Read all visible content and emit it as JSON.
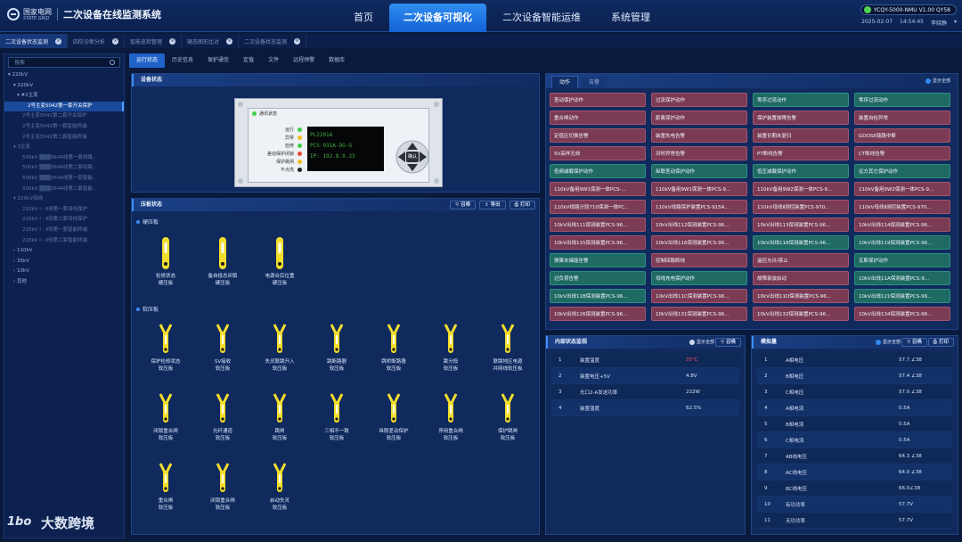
{
  "header": {
    "logo_cn": "国家电网",
    "logo_en": "STATE GRID",
    "title": "二次设备在线监测系统",
    "nav": [
      {
        "label": "首页"
      },
      {
        "label": "二次设备可视化"
      },
      {
        "label": "二次设备智能运维"
      },
      {
        "label": "系统管理"
      }
    ],
    "device": "YCQY-5000-NMU V1.00 QY58",
    "date": "2025-02-07",
    "time": "14:54:45",
    "user": "李晓静"
  },
  "tabs": [
    {
      "label": "二次设备状态监测"
    },
    {
      "label": "四防诊断分析"
    },
    {
      "label": "智能巡检管理"
    },
    {
      "label": "硬态图形比对"
    },
    {
      "label": "二次设备状态监测"
    }
  ],
  "sidebar": {
    "search_placeholder": "搜索",
    "tree": [
      {
        "label": "▾ 220kV"
      },
      {
        "label": "  ▾ 220kV"
      },
      {
        "label": "    ▾ #2主变"
      },
      {
        "label": "2号主变5042第一套开关保护"
      },
      {
        "label": "2号主变5042第二套开关保护"
      },
      {
        "label": "2号主变5042第一套智能终端"
      },
      {
        "label": "2号主变5042第二套智能终端"
      },
      {
        "label": "  ▾ 3主变"
      },
      {
        "label": "500kV ▒▒▒5644线第一套线路..."
      },
      {
        "label": "500kV ▒▒▒5644线第二套线路..."
      },
      {
        "label": "500kV ▒▒▒5644线第一套智能..."
      },
      {
        "label": "500kV ▒▒▒5644线第二套智能..."
      },
      {
        "label": "  ▾ 220kV母线"
      },
      {
        "label": "220kV Ⅰ - Ⅱ母第一套母线保护"
      },
      {
        "label": "220kV Ⅰ - Ⅱ母第二套母线保护"
      },
      {
        "label": "220kV Ⅰ - Ⅱ母第一套智能终端"
      },
      {
        "label": "220kV Ⅰ - Ⅱ母第二套智能终端"
      },
      {
        "label": "› 110kV"
      },
      {
        "label": "› 35kV"
      },
      {
        "label": "› 10kV"
      },
      {
        "label": "› 其他"
      }
    ]
  },
  "main_tabs": [
    {
      "label": "运行状态"
    },
    {
      "label": "历史信息"
    },
    {
      "label": "保护通信"
    },
    {
      "label": "定值"
    },
    {
      "label": "文件"
    },
    {
      "label": "远程预警"
    },
    {
      "label": "数据库"
    }
  ],
  "device_status": {
    "title": "设备状态",
    "comm_label": "通讯状态",
    "leds": [
      {
        "label": "运行",
        "color": "#3fd14a"
      },
      {
        "label": "异常",
        "color": "#f0c020"
      },
      {
        "label": "检修",
        "color": "#3fd14a"
      },
      {
        "label": "差动保护闭锁",
        "color": "#e84a3a"
      },
      {
        "label": "保护跳闸",
        "color": "#f0c020"
      },
      {
        "label": "不点亮",
        "color": "#222222"
      }
    ],
    "screen_lines": [
      "PL2201A",
      "PCS-931A-DG-G",
      "IP: 192.8.9.33"
    ],
    "center_key": "确认"
  },
  "plate_panel": {
    "title": "压板状态",
    "buttons": {
      "refresh": "召唤",
      "export": "导出",
      "print": "打印"
    },
    "hard_label": "硬压板",
    "soft_label": "软压板",
    "hard_plates": [
      {
        "name": "检修状态",
        "type": "硬压板"
      },
      {
        "name": "备自投总闭锁",
        "type": "硬压板"
      },
      {
        "name": "电源合后位置",
        "type": "硬压板"
      }
    ],
    "soft_plates": [
      {
        "name": "保护检修状态",
        "type": "软压板"
      },
      {
        "name": "SV接收",
        "type": "软压板"
      },
      {
        "name": "失灵联跳开入",
        "type": "软压板"
      },
      {
        "name": "跳断路器",
        "type": "软压板"
      },
      {
        "name": "跳桥断路器",
        "type": "软压板"
      },
      {
        "name": "跳分段",
        "type": "软压板"
      },
      {
        "name": "联跳地区电源",
        "type": "并网线软压板"
      },
      {
        "name": "闭锁重合闸",
        "type": "软压板"
      },
      {
        "name": "光纤通道",
        "type": "软压板"
      },
      {
        "name": "跳闸",
        "type": "软压板"
      },
      {
        "name": "三相不一致",
        "type": "软压板"
      },
      {
        "name": "纵联差动保护",
        "type": "软压板"
      },
      {
        "name": "停用重合闸",
        "type": "软压板"
      },
      {
        "name": "保护跳闸",
        "type": "软压板"
      },
      {
        "name": "重合闸",
        "type": "软压板"
      },
      {
        "name": "闭锁重合闸",
        "type": "软压板"
      },
      {
        "name": "启动失灵",
        "type": "软压板"
      }
    ]
  },
  "right_tabs": [
    {
      "label": "动作"
    },
    {
      "label": "告警"
    }
  ],
  "show_all": "显示全部",
  "alarms": [
    {
      "label": "差动保护动作",
      "color": "red"
    },
    {
      "label": "过流保护动作",
      "color": "red"
    },
    {
      "label": "零序过流动作",
      "color": "green"
    },
    {
      "label": "零序过流动作",
      "color": "green"
    },
    {
      "label": "重合闸动作",
      "color": "red"
    },
    {
      "label": "距离保护动作",
      "color": "red"
    },
    {
      "label": "保护装置故障告警",
      "color": "red"
    },
    {
      "label": "装置自检异常",
      "color": "red"
    },
    {
      "label": "定值区切换告警",
      "color": "red"
    },
    {
      "label": "装置失电告警",
      "color": "red"
    },
    {
      "label": "装置长期未复归",
      "color": "red"
    },
    {
      "label": "GOOSE链路中断",
      "color": "red"
    },
    {
      "label": "SV采样无效",
      "color": "red"
    },
    {
      "label": "对时异常告警",
      "color": "red"
    },
    {
      "label": "PT断线告警",
      "color": "red"
    },
    {
      "label": "CT断线告警",
      "color": "red"
    },
    {
      "label": "低频减载保护动作",
      "color": "green"
    },
    {
      "label": "纵联差动保护动作",
      "color": "green"
    },
    {
      "label": "低压减载保护动作",
      "color": "green"
    },
    {
      "label": "远方其它保护动作",
      "color": "green"
    },
    {
      "label": "110kV备用9W1保测一体PCS-...",
      "color": "red"
    },
    {
      "label": "110kV备用9W1保测一体PCS-9...",
      "color": "red"
    },
    {
      "label": "110kV备用9W2保测一体PCS-9...",
      "color": "red"
    },
    {
      "label": "110kV备用9W2保测一体PCS-9...",
      "color": "red"
    },
    {
      "label": "110kV线路分段710保测一体PC...",
      "color": "red"
    },
    {
      "label": "110kV线路保护装置PCS-915A...",
      "color": "red"
    },
    {
      "label": "110kV母线Ⅱ测控装置PCS-970...",
      "color": "red"
    },
    {
      "label": "110kV母线Ⅱ测控装置PCS-970...",
      "color": "red"
    },
    {
      "label": "10kV出线111保测装置PCS-96...",
      "color": "red"
    },
    {
      "label": "10kV出线112保测装置PCS-96...",
      "color": "red"
    },
    {
      "label": "10kV出线113保测装置PCS-96...",
      "color": "red"
    },
    {
      "label": "10kV出线114保测装置PCS-96...",
      "color": "red"
    },
    {
      "label": "10kV出线115保测装置PCS-96...",
      "color": "red"
    },
    {
      "label": "10kV出线116保测装置PCS-96...",
      "color": "red"
    },
    {
      "label": "10kV出线118保测装置PCS-96...",
      "color": "green"
    },
    {
      "label": "10kV出线119保测装置PCS-96...",
      "color": "green"
    },
    {
      "label": "弹簧未储能告警",
      "color": "green"
    },
    {
      "label": "控制回路断线",
      "color": "red"
    },
    {
      "label": "遥控允许/禁止",
      "color": "red"
    },
    {
      "label": "瓦斯保护动作",
      "color": "green"
    },
    {
      "label": "过负荷告警",
      "color": "green"
    },
    {
      "label": "母线充电保护动作",
      "color": "green"
    },
    {
      "label": "故障录波启动",
      "color": "red"
    },
    {
      "label": "10kV出线11A保测装置PCS-9...",
      "color": "green"
    },
    {
      "label": "10kV出线11B保测装置PCS-96...",
      "color": "green"
    },
    {
      "label": "10kV出线11C保测装置PCS-96...",
      "color": "red"
    },
    {
      "label": "10kV出线11D保测装置PCS-96...",
      "color": "red"
    },
    {
      "label": "10kV出线121保测装置PCS-96...",
      "color": "green"
    },
    {
      "label": "10kV出线126保测装置PCS-96...",
      "color": "red"
    },
    {
      "label": "10kV出线131保测装置PCS-96...",
      "color": "red"
    },
    {
      "label": "10kV出线132保测装置PCS-96...",
      "color": "red"
    },
    {
      "label": "10kV出线134保测装置PCS-96...",
      "color": "red"
    }
  ],
  "internal": {
    "title": "内部状态监视",
    "show_all": "显示全部",
    "refresh": "召唤",
    "rows": [
      {
        "idx": "1",
        "name": "装置温度",
        "value": "35℃",
        "alert": true
      },
      {
        "idx": "2",
        "name": "装置电压+5V",
        "value": "4.8V",
        "alert": false
      },
      {
        "idx": "3",
        "name": "光口2-A发送功率",
        "value": "232W",
        "alert": false
      },
      {
        "idx": "4",
        "name": "装置湿度",
        "value": "62.5%",
        "alert": false
      }
    ]
  },
  "analog": {
    "title": "模拟量",
    "show_all": "显示全部",
    "refresh": "召唤",
    "print": "打印",
    "rows": [
      {
        "idx": "1",
        "name": "A相电压",
        "value": "57.7 ∠38"
      },
      {
        "idx": "2",
        "name": "B相电压",
        "value": "57.4 ∠38"
      },
      {
        "idx": "3",
        "name": "C相电压",
        "value": "57.0 ∠38"
      },
      {
        "idx": "4",
        "name": "A相电流",
        "value": "0.5A"
      },
      {
        "idx": "5",
        "name": "B相电流",
        "value": "0.5A"
      },
      {
        "idx": "6",
        "name": "C相电流",
        "value": "0.5A"
      },
      {
        "idx": "7",
        "name": "AB线电压",
        "value": "64.3 ∠38"
      },
      {
        "idx": "8",
        "name": "AC线电压",
        "value": "64.0 ∠38"
      },
      {
        "idx": "9",
        "name": "BC线电压",
        "value": "66.0∠38"
      },
      {
        "idx": "10",
        "name": "有功功率",
        "value": "57.7V"
      },
      {
        "idx": "11",
        "name": "无功功率",
        "value": "57.7V"
      }
    ]
  },
  "watermark": {
    "logo": "1bo",
    "text": "大数跨境"
  },
  "colors": {
    "accent": "#2f8df0",
    "alarm_red": "#7b3b55",
    "alarm_green": "#1f6a62",
    "plate_yellow": "#f3de2c"
  }
}
